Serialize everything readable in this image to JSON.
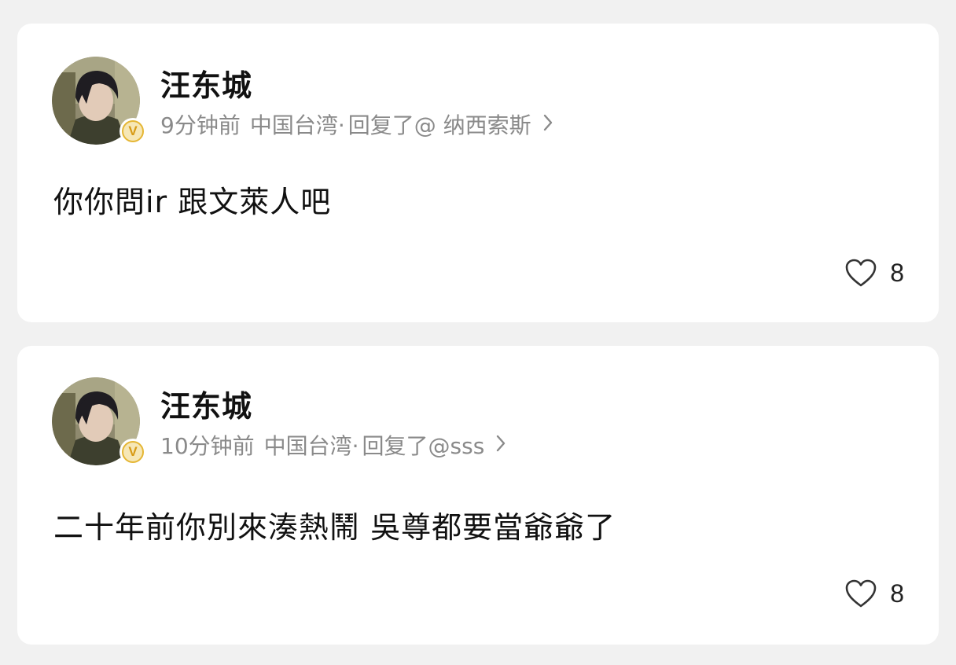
{
  "comments": [
    {
      "username": "汪东城",
      "time": "9分钟前",
      "location": "中国台湾·",
      "reply": "回复了@ 纳西索斯",
      "text": "你你問ir 跟文萊人吧",
      "likes": "8",
      "verified_badge": "V"
    },
    {
      "username": "汪东城",
      "time": "10分钟前",
      "location": "中国台湾·",
      "reply": "回复了@sss",
      "text": "二十年前你別來湊熱鬧 吳尊都要當爺爺了",
      "likes": "8",
      "verified_badge": "V"
    }
  ],
  "icons": {
    "like": "heart-icon",
    "reply_arrow": "chevron-right-icon",
    "badge": "verified-badge-icon"
  },
  "colors": {
    "background": "#f1f1f1",
    "card": "#ffffff",
    "meta_text": "#8a8a8a",
    "badge": "#e5b634"
  }
}
